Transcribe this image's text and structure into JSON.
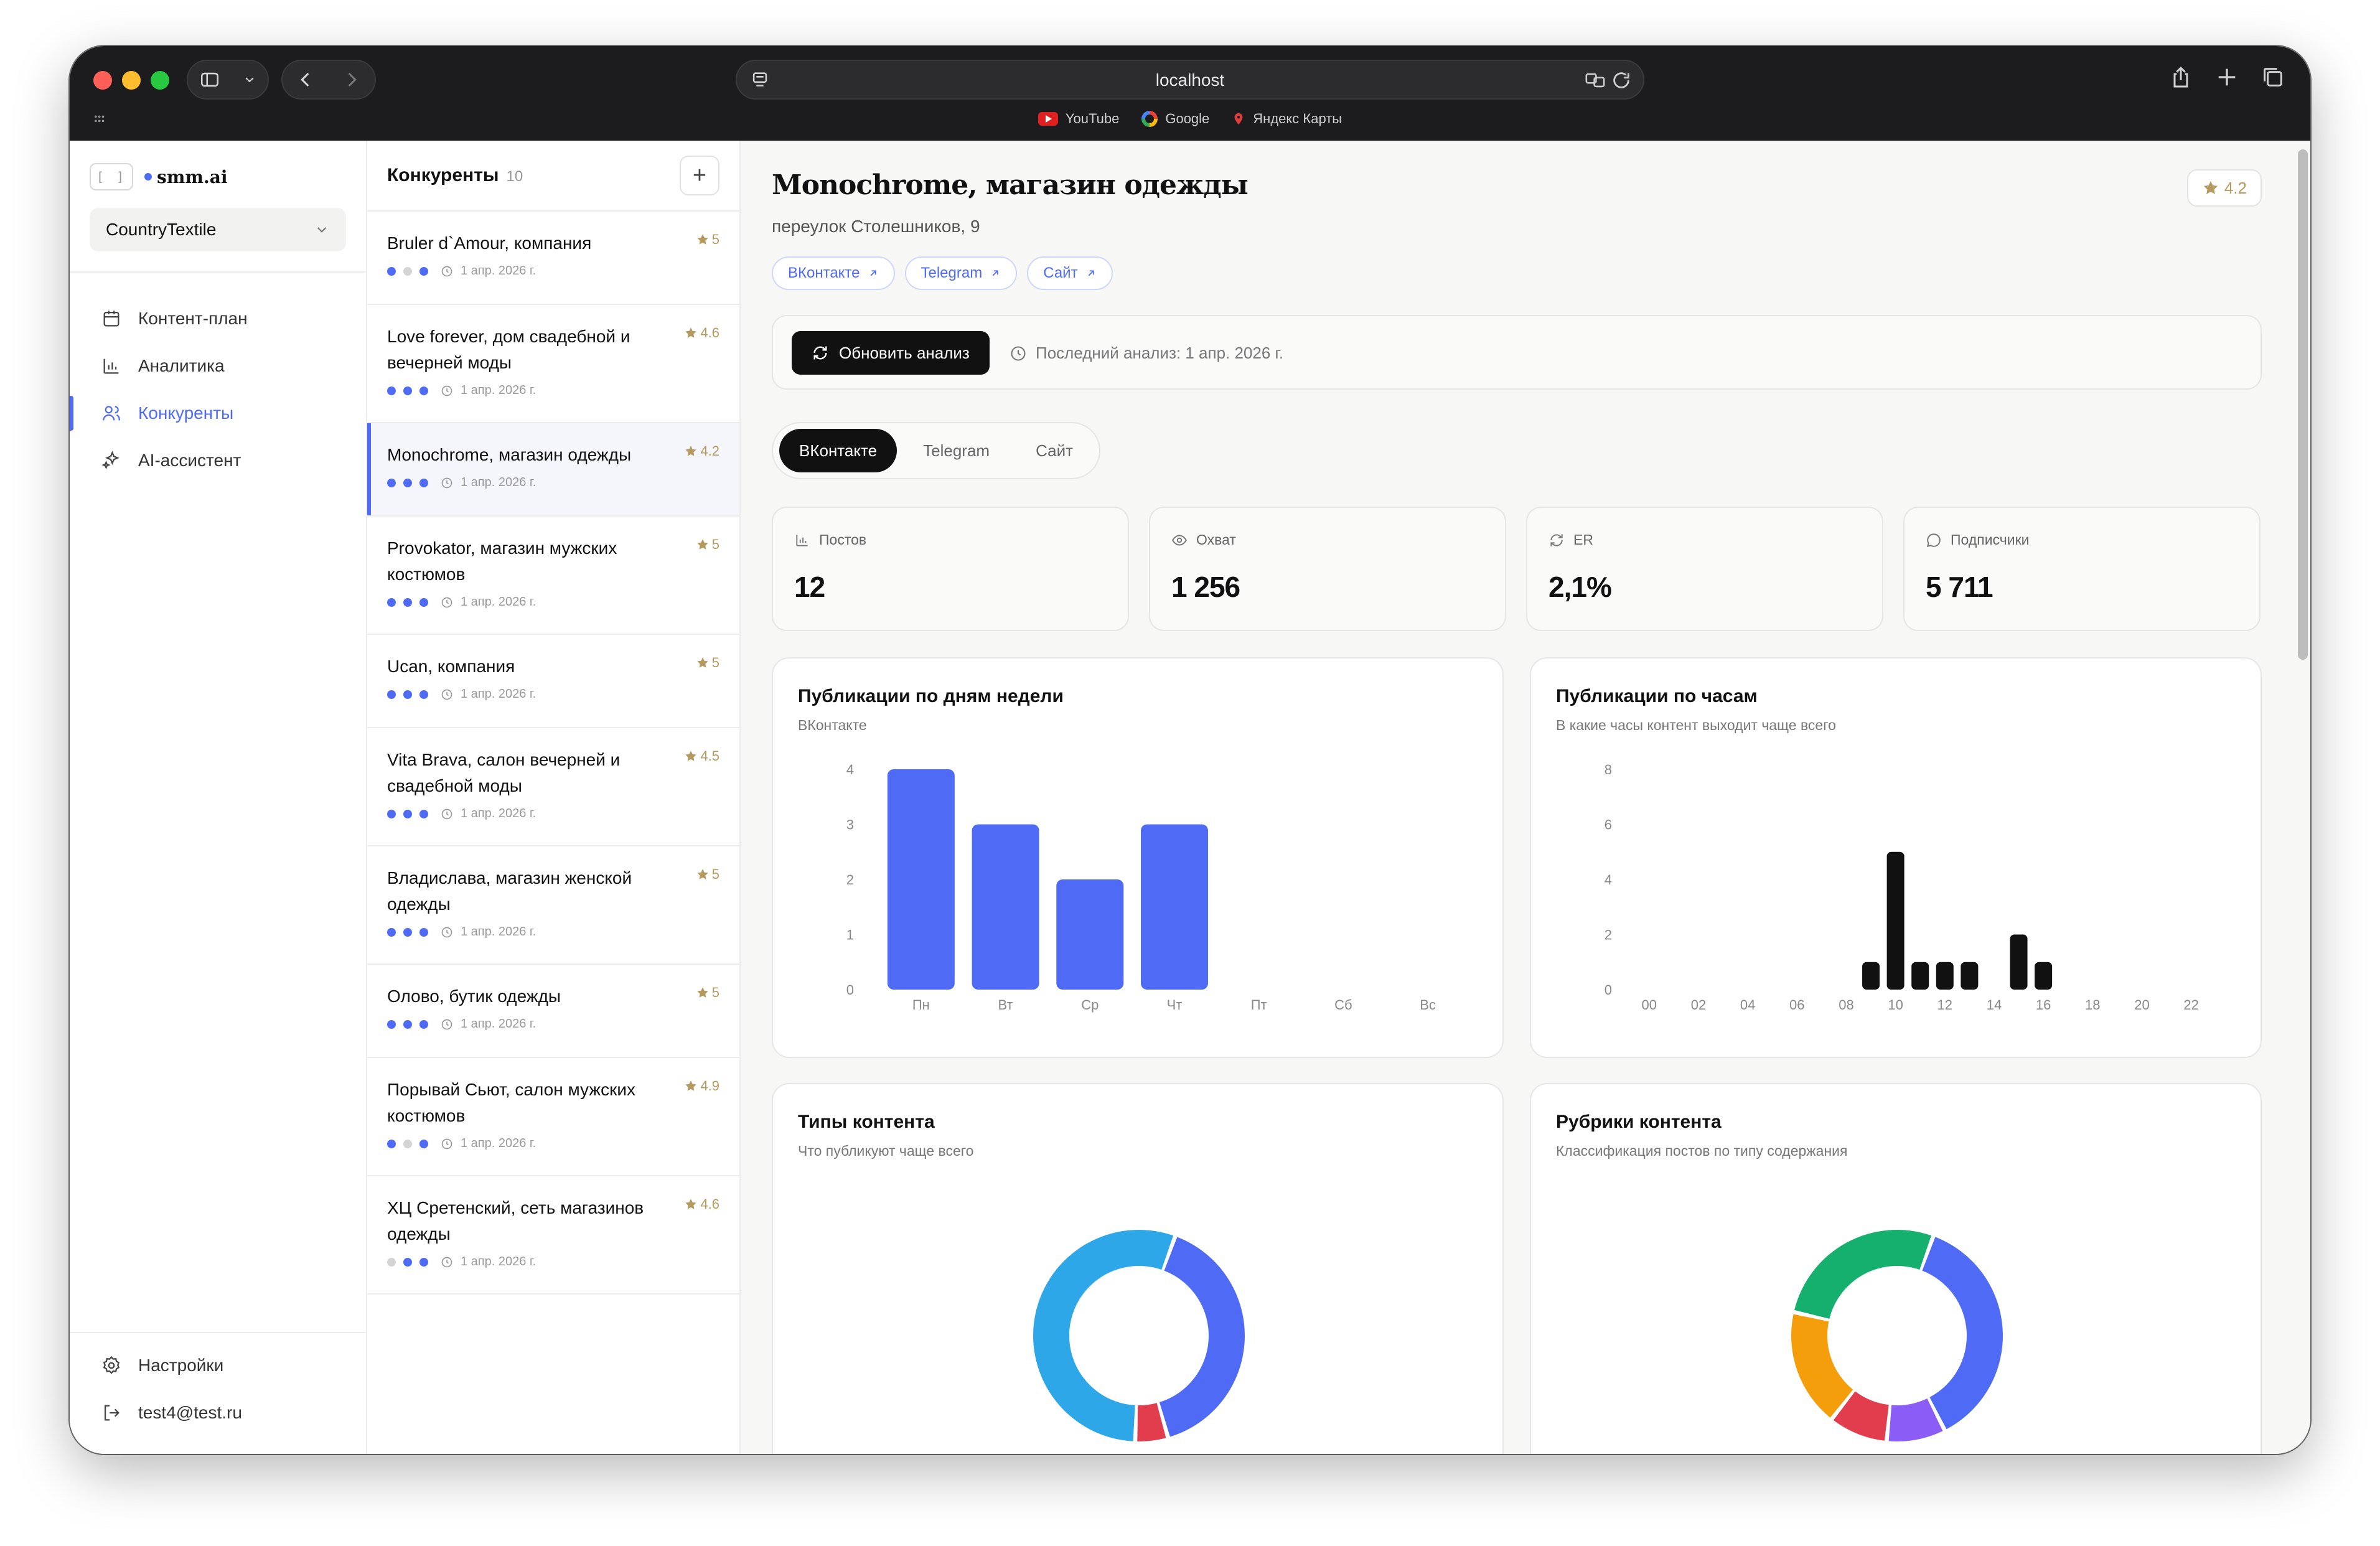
{
  "browser": {
    "url": "localhost",
    "bookmarks": [
      {
        "label": "YouTube",
        "icon": "youtube-icon"
      },
      {
        "label": "Google",
        "icon": "google-icon"
      },
      {
        "label": "Яндекс Карты",
        "icon": "map-pin-icon"
      }
    ]
  },
  "sidebar": {
    "logo_box": "[ ]",
    "logo_text": "smm.ai",
    "workspace": "CountryTextile",
    "nav": [
      {
        "label": "Контент-план",
        "icon": "calendar-icon"
      },
      {
        "label": "Аналитика",
        "icon": "bar-chart-icon"
      },
      {
        "label": "Конкуренты",
        "icon": "users-icon",
        "active": true
      },
      {
        "label": "AI-ассистент",
        "icon": "sparkles-icon"
      }
    ],
    "settings": "Настройки",
    "user": "test4@test.ru"
  },
  "competitors": {
    "title": "Конкуренты",
    "count": "10",
    "add_label": "+",
    "items": [
      {
        "name": "Bruler d`Amour, компания",
        "rating": "5",
        "dots": [
          true,
          false,
          true
        ],
        "date": "1 апр. 2026 г."
      },
      {
        "name": "Love forever, дом свадебной и вечерней моды",
        "rating": "4.6",
        "dots": [
          true,
          true,
          true
        ],
        "date": "1 апр. 2026 г."
      },
      {
        "name": "Monochrome, магазин одежды",
        "rating": "4.2",
        "dots": [
          true,
          true,
          true
        ],
        "date": "1 апр. 2026 г.",
        "active": true
      },
      {
        "name": "Provokator, магазин мужских костюмов",
        "rating": "5",
        "dots": [
          true,
          true,
          true
        ],
        "date": "1 апр. 2026 г."
      },
      {
        "name": "Ucan, компания",
        "rating": "5",
        "dots": [
          true,
          true,
          true
        ],
        "date": "1 апр. 2026 г."
      },
      {
        "name": "Vita Brava, салон вечерней и свадебной моды",
        "rating": "4.5",
        "dots": [
          true,
          true,
          true
        ],
        "date": "1 апр. 2026 г."
      },
      {
        "name": "Владислава, магазин женской одежды",
        "rating": "5",
        "dots": [
          true,
          true,
          true
        ],
        "date": "1 апр. 2026 г."
      },
      {
        "name": "Олово, бутик одежды",
        "rating": "5",
        "dots": [
          true,
          true,
          true
        ],
        "date": "1 апр. 2026 г."
      },
      {
        "name": "Порывай Сьют, салон мужских костюмов",
        "rating": "4.9",
        "dots": [
          true,
          false,
          true
        ],
        "date": "1 апр. 2026 г."
      },
      {
        "name": "ХЦ Сретенский, сеть магазинов одежды",
        "rating": "4.6",
        "dots": [
          false,
          true,
          true
        ],
        "date": "1 апр. 2026 г."
      }
    ]
  },
  "detail": {
    "title": "Monochrome, магазин одежды",
    "rating": "4.2",
    "address": "переулок Столешников, 9",
    "links": [
      "ВКонтакте",
      "Telegram",
      "Сайт"
    ],
    "refresh_label": "Обновить анализ",
    "last_analysis": "Последний анализ: 1 апр. 2026 г.",
    "tabs": [
      "ВКонтакте",
      "Telegram",
      "Сайт"
    ],
    "active_tab": 0,
    "stats": [
      {
        "label": "Постов",
        "value": "12",
        "icon": "bar-chart-icon"
      },
      {
        "label": "Охват",
        "value": "1 256",
        "icon": "eye-icon"
      },
      {
        "label": "ER",
        "value": "2,1%",
        "icon": "refresh-icon"
      },
      {
        "label": "Подписчики",
        "value": "5 711",
        "icon": "chat-bubble-icon"
      }
    ],
    "cards": {
      "weekday": {
        "title": "Публикации по дням недели",
        "subtitle": "ВКонтакте"
      },
      "hours": {
        "title": "Публикации по часам",
        "subtitle": "В какие часы контент выходит чаще всего"
      },
      "types": {
        "title": "Типы контента",
        "subtitle": "Что публикуют чаще всего"
      },
      "rubrics": {
        "title": "Рубрики контента",
        "subtitle": "Классификация постов по типу содержания"
      }
    }
  },
  "chart_data": [
    {
      "type": "bar",
      "title": "Публикации по дням недели",
      "subtitle": "ВКонтакте",
      "categories": [
        "Пн",
        "Вт",
        "Ср",
        "Чт",
        "Пт",
        "Сб",
        "Вс"
      ],
      "values": [
        4,
        3,
        2,
        3,
        0,
        0,
        0
      ],
      "yticks": [
        0,
        1,
        2,
        3,
        4
      ],
      "ylim": [
        0,
        4
      ],
      "color": "#4f6bf5"
    },
    {
      "type": "bar",
      "title": "Публикации по часам",
      "subtitle": "В какие часы контент выходит чаще всего",
      "x": [
        0,
        1,
        2,
        3,
        4,
        5,
        6,
        7,
        8,
        9,
        10,
        11,
        12,
        13,
        14,
        15,
        16,
        17,
        18,
        19,
        20,
        21,
        22,
        23
      ],
      "xticks": [
        "00",
        "02",
        "04",
        "06",
        "08",
        "10",
        "12",
        "14",
        "16",
        "18",
        "20",
        "22"
      ],
      "values": [
        0,
        0,
        0,
        0,
        0,
        0,
        0,
        0,
        0,
        1,
        5,
        1,
        1,
        1,
        0,
        2,
        1,
        0,
        0,
        0,
        0,
        0,
        0,
        0
      ],
      "yticks": [
        0,
        2,
        4,
        6,
        8
      ],
      "ylim": [
        0,
        8
      ],
      "color": "#111111"
    },
    {
      "type": "pie",
      "title": "Типы контента",
      "subtitle": "Что публикуют чаще всего",
      "donut": true,
      "slices": [
        {
          "value": 0.4,
          "color": "#4f6bf5"
        },
        {
          "value": 0.05,
          "color": "#e23d4d"
        },
        {
          "value": 0.55,
          "color": "#2ea7e8"
        }
      ]
    },
    {
      "type": "pie",
      "title": "Рубрики контента",
      "subtitle": "Классификация постов по типу содержания",
      "donut": true,
      "slices": [
        {
          "value": 0.37,
          "color": "#4f6bf5"
        },
        {
          "value": 0.09,
          "color": "#8b5cf6"
        },
        {
          "value": 0.09,
          "color": "#e23d4d"
        },
        {
          "value": 0.18,
          "color": "#f59e0b"
        },
        {
          "value": 0.27,
          "color": "#16b06e"
        }
      ]
    }
  ]
}
